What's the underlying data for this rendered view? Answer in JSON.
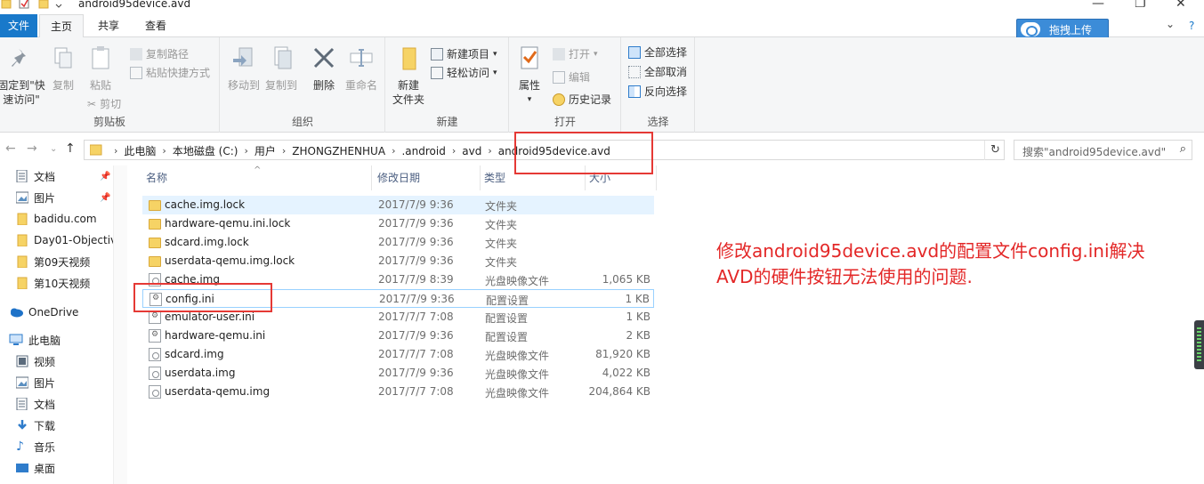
{
  "window": {
    "title": "android95device.avd"
  },
  "tabs": {
    "file": "文件",
    "home": "主页",
    "share": "共享",
    "view": "查看"
  },
  "upload_button": "拖拽上传",
  "ribbon": {
    "clipboard": {
      "label": "剪贴板",
      "pin_quick_access": [
        "固定到\"快",
        "速访问\""
      ],
      "copy": "复制",
      "paste": "粘贴",
      "copy_path": "复制路径",
      "paste_shortcut": "粘贴快捷方式",
      "cut": "剪切"
    },
    "organize": {
      "label": "组织",
      "move_to": "移动到",
      "copy_to": "复制到",
      "delete": "删除",
      "rename": "重命名"
    },
    "new": {
      "label": "新建",
      "new_folder": [
        "新建",
        "文件夹"
      ],
      "new_item": "新建项目",
      "easy_access": "轻松访问"
    },
    "open": {
      "label": "打开",
      "properties": "属性",
      "open": "打开",
      "edit": "编辑",
      "history": "历史记录"
    },
    "select": {
      "label": "选择",
      "select_all": "全部选择",
      "select_none": "全部取消",
      "invert": "反向选择"
    }
  },
  "breadcrumb": [
    "此电脑",
    "本地磁盘 (C:)",
    "用户",
    "ZHONGZHENHUA",
    ".android",
    "avd",
    "android95device.avd"
  ],
  "search": {
    "placeholder": "搜索\"android95device.avd\""
  },
  "sidebar": {
    "quick": [
      {
        "label": "文档",
        "icon": "documents-icon",
        "pinned": true
      },
      {
        "label": "图片",
        "icon": "pictures-icon",
        "pinned": true
      },
      {
        "label": "badidu.com",
        "icon": "folder-icon"
      },
      {
        "label": "Day01-Objectiv",
        "icon": "folder-icon"
      },
      {
        "label": "第09天视频",
        "icon": "folder-icon"
      },
      {
        "label": "第10天视频",
        "icon": "folder-icon"
      }
    ],
    "onedrive": "OneDrive",
    "this_pc": "此电脑",
    "pc_items": [
      {
        "label": "视频",
        "icon": "videos-icon"
      },
      {
        "label": "图片",
        "icon": "pictures-icon"
      },
      {
        "label": "文档",
        "icon": "documents-icon"
      },
      {
        "label": "下载",
        "icon": "downloads-icon"
      },
      {
        "label": "音乐",
        "icon": "music-icon"
      },
      {
        "label": "桌面",
        "icon": "desktop-icon"
      }
    ]
  },
  "columns": {
    "name": "名称",
    "date": "修改日期",
    "type": "类型",
    "size": "大小"
  },
  "files": [
    {
      "name": "cache.img.lock",
      "date": "2017/7/9 9:36",
      "type": "文件夹",
      "size": "",
      "icon": "folder"
    },
    {
      "name": "hardware-qemu.ini.lock",
      "date": "2017/7/9 9:36",
      "type": "文件夹",
      "size": "",
      "icon": "folder"
    },
    {
      "name": "sdcard.img.lock",
      "date": "2017/7/9 9:36",
      "type": "文件夹",
      "size": "",
      "icon": "folder"
    },
    {
      "name": "userdata-qemu.img.lock",
      "date": "2017/7/9 9:36",
      "type": "文件夹",
      "size": "",
      "icon": "folder"
    },
    {
      "name": "cache.img",
      "date": "2017/7/9 8:39",
      "type": "光盘映像文件",
      "size": "1,065 KB",
      "icon": "disc"
    },
    {
      "name": "config.ini",
      "date": "2017/7/9 9:36",
      "type": "配置设置",
      "size": "1 KB",
      "icon": "cfg"
    },
    {
      "name": "emulator-user.ini",
      "date": "2017/7/7 7:08",
      "type": "配置设置",
      "size": "1 KB",
      "icon": "cfg"
    },
    {
      "name": "hardware-qemu.ini",
      "date": "2017/7/9 9:36",
      "type": "配置设置",
      "size": "2 KB",
      "icon": "cfg"
    },
    {
      "name": "sdcard.img",
      "date": "2017/7/7 7:08",
      "type": "光盘映像文件",
      "size": "81,920 KB",
      "icon": "disc"
    },
    {
      "name": "userdata.img",
      "date": "2017/7/9 9:36",
      "type": "光盘映像文件",
      "size": "4,022 KB",
      "icon": "disc"
    },
    {
      "name": "userdata-qemu.img",
      "date": "2017/7/7 7:08",
      "type": "光盘映像文件",
      "size": "204,864 KB",
      "icon": "disc"
    }
  ],
  "annotation": {
    "line1": "修改android95device.avd的配置文件config.ini解决",
    "line2": "AVD的硬件按钮无法使用的问题.",
    "color": "#e32727"
  },
  "colors": {
    "file_tab": "#1979ca",
    "selection": "#e5f3ff",
    "highlight_box": "#e53935"
  }
}
